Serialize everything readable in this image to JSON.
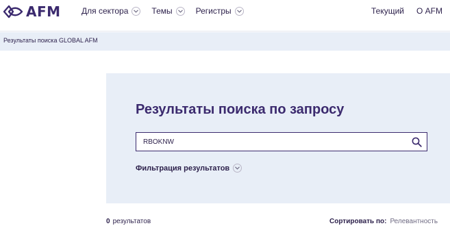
{
  "header": {
    "logo_text": "AFM",
    "nav": [
      {
        "label": "Для сектора"
      },
      {
        "label": "Темы"
      },
      {
        "label": "Регистры"
      }
    ],
    "right_links": [
      {
        "label": "Текущий"
      },
      {
        "label": "О AFM"
      }
    ],
    "colors": {
      "brand": "#3b2a6e",
      "panel": "#e8eef7"
    }
  },
  "breadcrumb": {
    "label": "Результаты поиска GLOBAL AFM"
  },
  "search": {
    "title": "Результаты поиска по запросу",
    "query": "RBOKNW",
    "button_icon": "search-icon",
    "filter_label": "Фильтрация результатов"
  },
  "results": {
    "count": "0",
    "count_label": "результатов",
    "sort_label": "Сортировать по:",
    "sort_value": "Релевантность"
  }
}
